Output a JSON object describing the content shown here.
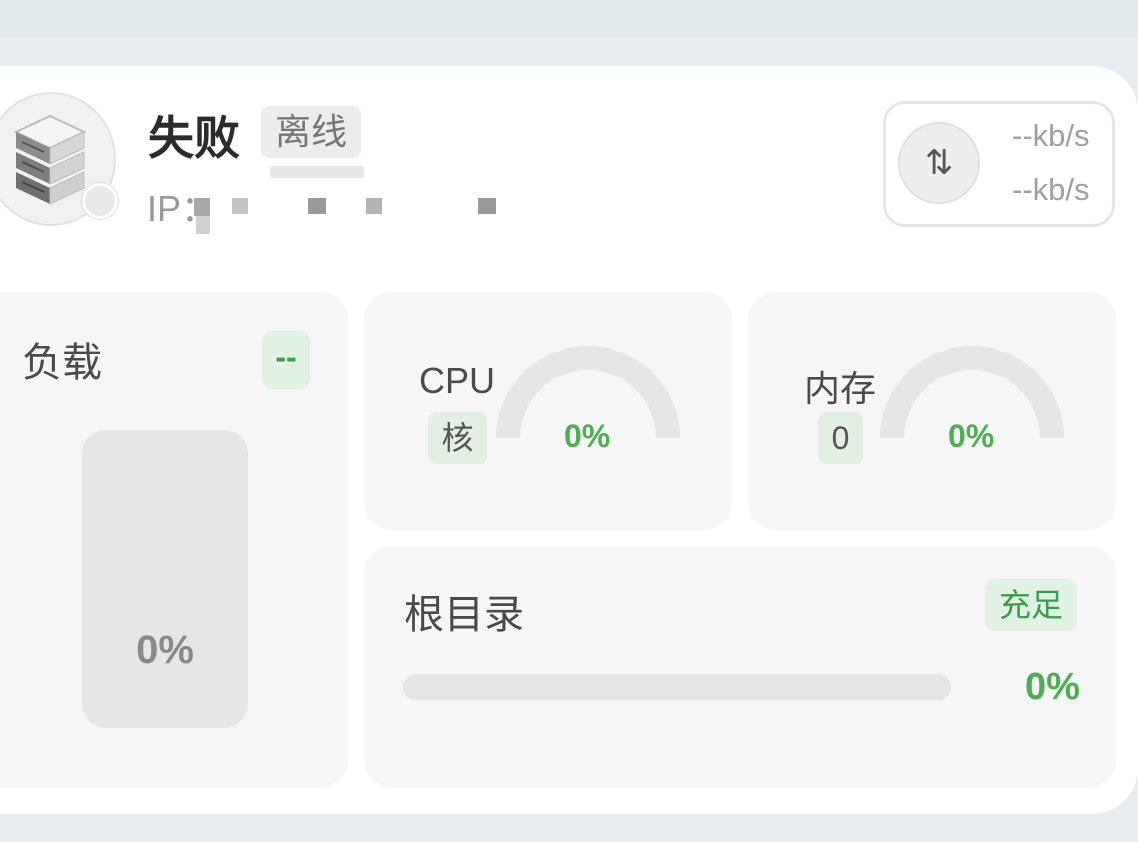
{
  "server": {
    "name": "失败",
    "status": "离线",
    "ip_label": "IP："
  },
  "network": {
    "icon": "up-down-arrows-icon",
    "upload": "--kb/s",
    "download": "--kb/s"
  },
  "load": {
    "title": "负载",
    "badge": "--",
    "value_text": "0%",
    "level": 0
  },
  "cpu": {
    "label": "CPU",
    "core_badge": "核",
    "value_text": "0%",
    "level": 0
  },
  "memory": {
    "label": "内存",
    "badge": "0",
    "value_text": "0%",
    "level": 0
  },
  "disk": {
    "title": "根目录",
    "badge": "充足",
    "value_text": "0%",
    "level": 0
  },
  "colors": {
    "accent_green": "#4caf50",
    "badge_green_bg": "#e1f1e3",
    "panel_bg": "#f6f6f6"
  }
}
